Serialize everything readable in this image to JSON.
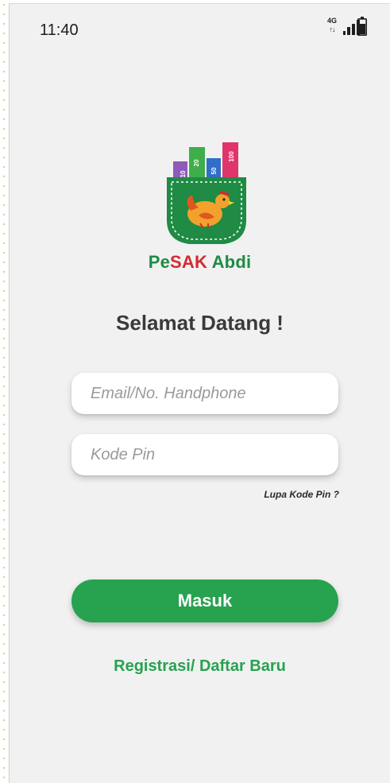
{
  "status_bar": {
    "time": "11:40",
    "network": "4G",
    "network_arrows": "↑↓",
    "signal_icon": "signal-bars-icon",
    "battery_icon": "battery-icon"
  },
  "logo": {
    "brand_prefix": "Pe",
    "brand_highlight": "SAK",
    "brand_suffix": "Abdi",
    "note_values": [
      "10",
      "20",
      "50",
      "100"
    ],
    "icon": "pocket-money-hen-logo",
    "colors": {
      "pocket": "#1f8b44",
      "brand_red": "#d42a32",
      "brand_green": "#1f8b44"
    }
  },
  "welcome": "Selamat Datang !",
  "form": {
    "email_placeholder": "Email/No. Handphone",
    "email_value": "",
    "pin_placeholder": "Kode Pin",
    "pin_value": "",
    "forgot_pin": "Lupa Kode Pin ?"
  },
  "actions": {
    "login_label": "Masuk",
    "register_label": "Registrasi/ Daftar Baru",
    "accent_color": "#27a24f"
  }
}
